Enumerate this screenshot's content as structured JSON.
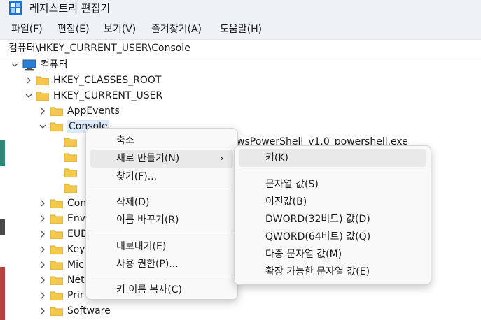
{
  "window": {
    "title": "레지스트리 편집기"
  },
  "menubar": {
    "items": [
      "파일(F)",
      "편집(E)",
      "보기(V)",
      "즐겨찾기(A)",
      "도움말(H)"
    ]
  },
  "address": {
    "path": "컴퓨터\\HKEY_CURRENT_USER\\Console"
  },
  "tree": {
    "root": "컴퓨터",
    "classes_root": "HKEY_CLASSES_ROOT",
    "current_user": "HKEY_CURRENT_USER",
    "app_events": "AppEvents",
    "console": "Console",
    "console_child_peek": "wsPowerShell_v1.0_powershell.exe",
    "children_partial": [
      "Con",
      "Env",
      "EUD",
      "Key",
      "Mic",
      "Net",
      "Prir"
    ],
    "software": "Software"
  },
  "context_menu": {
    "items": [
      {
        "label": "축소"
      },
      {
        "label": "새로 만들기(N)",
        "submenu_arrow": "›"
      },
      {
        "label": "찾기(F)..."
      },
      {
        "label": "삭제(D)"
      },
      {
        "label": "이름 바꾸기(R)"
      },
      {
        "label": "내보내기(E)"
      },
      {
        "label": "사용 권한(P)..."
      },
      {
        "label": "키 이름 복사(C)"
      }
    ]
  },
  "submenu": {
    "items": [
      {
        "label": "키(K)"
      },
      {
        "label": "문자열 값(S)"
      },
      {
        "label": "이진값(B)"
      },
      {
        "label": "DWORD(32비트) 값(D)"
      },
      {
        "label": "QWORD(64비트) 값(Q)"
      },
      {
        "label": "다중 문자열 값(M)"
      },
      {
        "label": "확장 가능한 문자열 값(E)"
      }
    ]
  },
  "colors": {
    "folder": "#f2c94c",
    "folder_dark": "#e0a92a",
    "selection": "#dbe8f7",
    "menu_bg": "#f9f9f9",
    "menu_hover": "#e9e9e9"
  }
}
